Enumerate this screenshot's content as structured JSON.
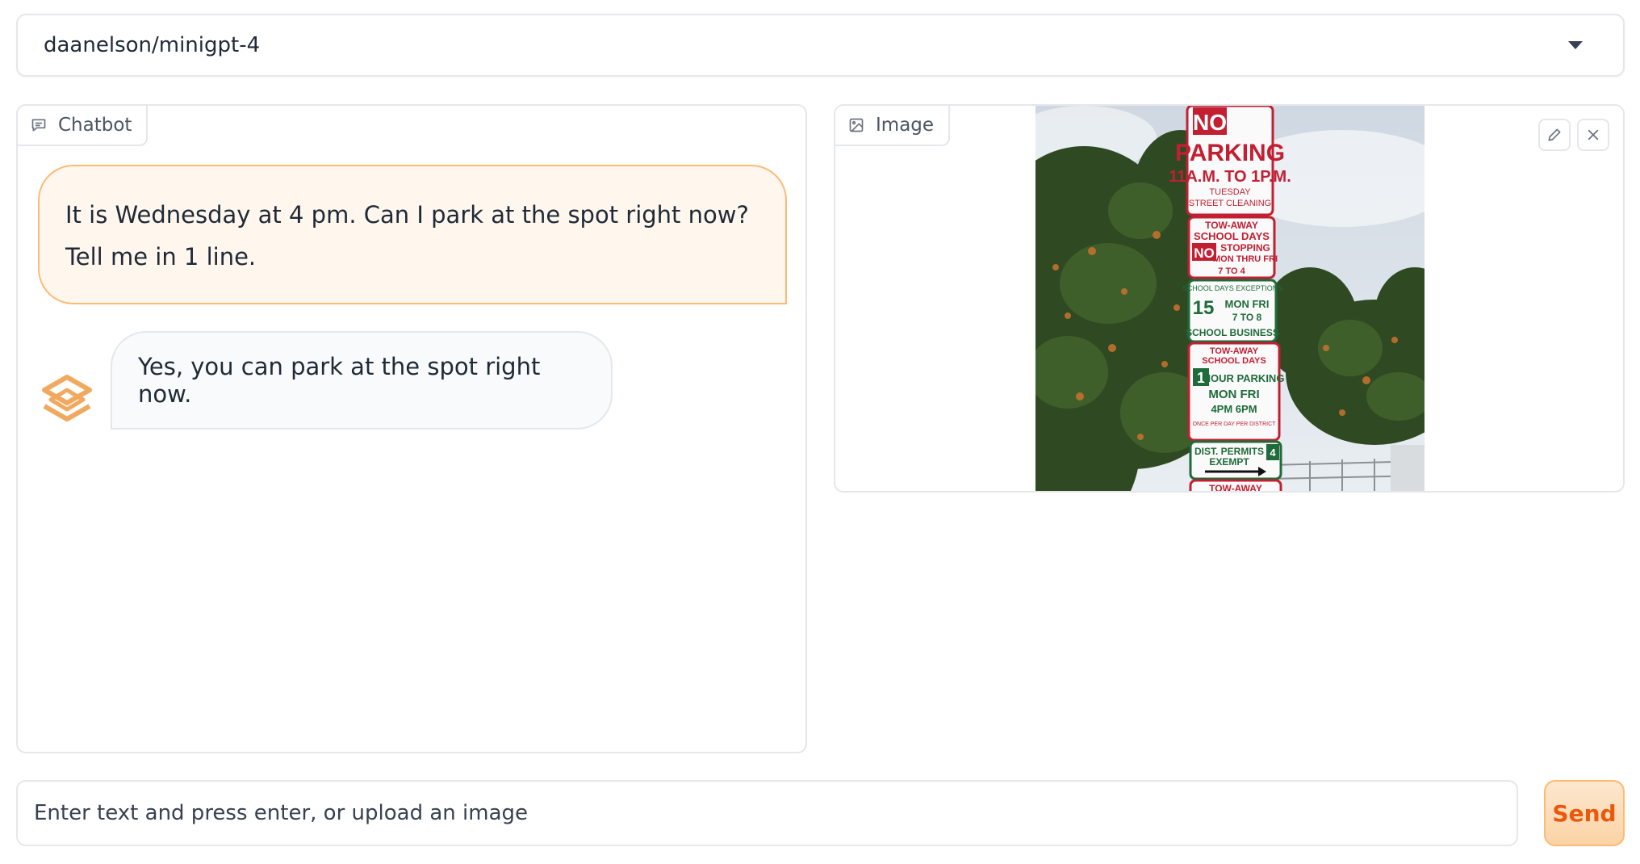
{
  "model_selector": {
    "value": "daanelson/minigpt-4"
  },
  "chatbot": {
    "label": "Chatbot",
    "messages": [
      {
        "role": "user",
        "text": "It is Wednesday at 4 pm. Can I park at the spot right now? Tell me in 1 line."
      },
      {
        "role": "bot",
        "text": "Yes, you can park at the spot right now."
      }
    ]
  },
  "image_panel": {
    "label": "Image",
    "photo_signs": {
      "sign1_line1": "NO",
      "sign1_line2": "PARKING",
      "sign1_line3": "11A.M. TO 1P.M.",
      "sign1_line4": "TUESDAY",
      "sign1_line5": "STREET CLEANING",
      "sign2_line1": "TOW-AWAY",
      "sign2_line2": "SCHOOL DAYS",
      "sign2_line3": "NO",
      "sign2_line4": "STOPPING",
      "sign2_line5": "MON THRU FRI",
      "sign2_line6": "7 TO 4",
      "sign3_line1": "SCHOOL DAYS EXCEPTIONS",
      "sign3_line2": "15",
      "sign3_line3": "MON FRI",
      "sign3_line4": "7 TO 8",
      "sign3_line5": "SCHOOL BUSINESS",
      "sign4_line1": "TOW-AWAY",
      "sign4_line2": "SCHOOL DAYS",
      "sign4_line3": "1",
      "sign4_line4": "HOUR PARKING",
      "sign4_line5": "MON FRI",
      "sign4_line6": "4PM 6PM",
      "sign4_line7": "ONCE PER DAY PER DISTRICT",
      "sign5_line1": "DIST. PERMITS",
      "sign5_line2": "EXEMPT",
      "sign5_line3": "4",
      "sign6_line1": "TOW-AWAY"
    }
  },
  "input": {
    "placeholder": "Enter text and press enter, or upload an image"
  },
  "send_button": {
    "label": "Send"
  },
  "colors": {
    "accent": "#ea580c",
    "user_bubble_bg": "#fff7ed",
    "user_bubble_border": "#fdba74",
    "bot_bubble_bg": "#f9fafb",
    "border": "#e5e7eb"
  },
  "icons": {
    "chatbot": "chat-bubble-icon",
    "image": "image-icon",
    "edit": "pencil-icon",
    "close": "close-icon",
    "dropdown": "chevron-down-icon",
    "avatar": "bot-logo-icon"
  }
}
